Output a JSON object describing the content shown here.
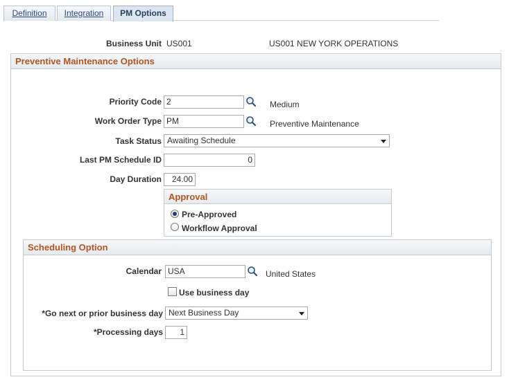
{
  "tabs": [
    {
      "label": "Definition"
    },
    {
      "label": "Integration"
    },
    {
      "label": "PM Options"
    }
  ],
  "business_unit": {
    "label": "Business Unit",
    "code": "US001",
    "description": "US001 NEW YORK OPERATIONS"
  },
  "pm_options": {
    "title": "Preventive Maintenance Options",
    "priority_code": {
      "label": "Priority Code",
      "value": "2",
      "description": "Medium"
    },
    "work_order_type": {
      "label": "Work Order Type",
      "value": "PM",
      "description": "Preventive Maintenance"
    },
    "task_status": {
      "label": "Task Status",
      "value": "Awaiting Schedule"
    },
    "last_pm_schedule_id": {
      "label": "Last PM Schedule ID",
      "value": "0"
    },
    "day_duration": {
      "label": "Day Duration",
      "value": "24.00"
    },
    "approval": {
      "title": "Approval",
      "options": [
        {
          "label": "Pre-Approved",
          "selected": true
        },
        {
          "label": "Workflow Approval",
          "selected": false
        }
      ]
    }
  },
  "scheduling": {
    "title": "Scheduling Option",
    "calendar": {
      "label": "Calendar",
      "value": "USA",
      "description": "United States"
    },
    "use_business_day": {
      "label": "Use business day",
      "checked": false
    },
    "go_next_or_prior": {
      "label": "*Go next or prior business day",
      "value": "Next Business Day"
    },
    "processing_days": {
      "label": "*Processing days",
      "value": "1"
    }
  },
  "colors": {
    "section_title": "#b4541e",
    "tab_active": "#dbe6f1",
    "link": "#2b4a7a"
  },
  "icons": {
    "lookup": "magnifier-icon",
    "dropdown": "chevron-down-icon"
  }
}
